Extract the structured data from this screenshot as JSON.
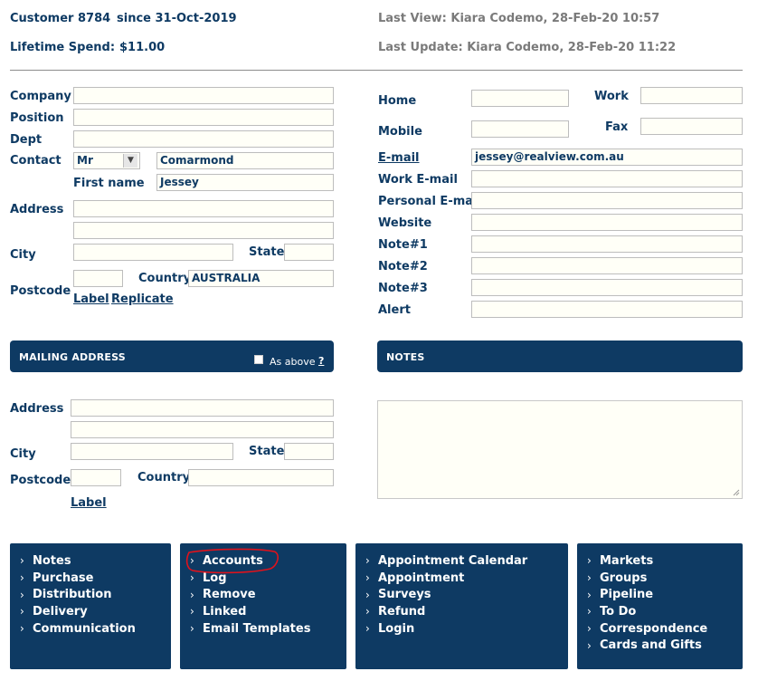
{
  "header": {
    "customer": "Customer 8784",
    "since": "since 31-Oct-2019",
    "lifetime_label": "Lifetime Spend:",
    "lifetime_value": "$11.00",
    "last_view": "Last View: Kiara Codemo, 28-Feb-20 10:57",
    "last_update": "Last Update: Kiara Codemo, 28-Feb-20 11:22"
  },
  "left": {
    "company_label": "Company",
    "position_label": "Position",
    "dept_label": "Dept",
    "contact_label": "Contact",
    "salutation_value": "Mr",
    "surname_value": "Comarmond",
    "firstname_label": "First name",
    "firstname_value": "Jessey",
    "address_label": "Address",
    "city_label": "City",
    "state_label": "State",
    "postcode_label": "Postcode",
    "country_label": "Country",
    "country_value": "AUSTRALIA",
    "label_link": "Label",
    "replicate_link": "Replicate"
  },
  "right": {
    "home_label": "Home",
    "work_label": "Work",
    "mobile_label": "Mobile",
    "fax_label": "Fax",
    "email_label": "E-mail",
    "email_value": "jessey@realview.com.au",
    "work_email_label": "Work E-mail",
    "personal_email_label": "Personal E-mail",
    "website_label": "Website",
    "note1_label": "Note#1",
    "note2_label": "Note#2",
    "note3_label": "Note#3",
    "alert_label": "Alert"
  },
  "mailing": {
    "title": "MAILING ADDRESS",
    "as_above": "As above",
    "help": "?",
    "address_label": "Address",
    "city_label": "City",
    "state_label": "State",
    "postcode_label": "Postcode",
    "country_label": "Country",
    "label_link": "Label"
  },
  "notes": {
    "title": "NOTES"
  },
  "menus": {
    "col1": [
      "Notes",
      "Purchase",
      "Distribution",
      "Delivery",
      "Communication"
    ],
    "col2": [
      "Accounts",
      "Log",
      "Remove",
      "Linked",
      "Email Templates"
    ],
    "col3": [
      "Appointment Calendar",
      "Appointment",
      "Surveys",
      "Refund",
      "Login"
    ],
    "col4": [
      "Markets",
      "Groups",
      "Pipeline",
      "To Do",
      "Correspondence",
      "Cards and Gifts"
    ]
  },
  "colors": {
    "brand_navy": "#0e3a63",
    "annotation_red": "#e0121b"
  }
}
